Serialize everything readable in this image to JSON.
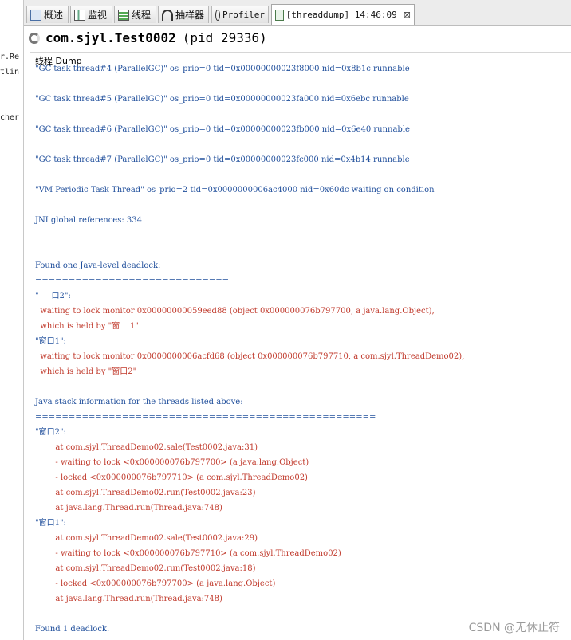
{
  "left_strip": [
    "r.Re",
    "tlin",
    "cher"
  ],
  "tabs": [
    {
      "label": "概述",
      "icon": "overview-icon"
    },
    {
      "label": "监视",
      "icon": "monitor-icon"
    },
    {
      "label": "线程",
      "icon": "threads-icon"
    },
    {
      "label": "抽样器",
      "icon": "sampler-icon"
    },
    {
      "label": "Profiler",
      "icon": "profiler-icon"
    },
    {
      "label": "[threaddump] 14:46:09",
      "icon": "threaddump-icon",
      "close": "⊠",
      "active": true
    }
  ],
  "header": {
    "app_name": "com.sjyl.Test0002",
    "pid": "(pid 29336)"
  },
  "subtab": "线程 Dump",
  "dump_lines": [
    {
      "text": "\"GC task thread#4 (ParallelGC)\" os_prio=0 tid=0x00000000023f8000 nid=0x8b1c runnable",
      "color": "blue"
    },
    {
      "text": "\"GC task thread#5 (ParallelGC)\" os_prio=0 tid=0x00000000023fa000 nid=0x6ebc runnable",
      "color": "blue"
    },
    {
      "text": "\"GC task thread#6 (ParallelGC)\" os_prio=0 tid=0x00000000023fb000 nid=0x6e40 runnable",
      "color": "blue"
    },
    {
      "text": "\"GC task thread#7 (ParallelGC)\" os_prio=0 tid=0x00000000023fc000 nid=0x4b14 runnable",
      "color": "blue"
    },
    {
      "text": "\"VM Periodic Task Thread\" os_prio=2 tid=0x0000000006ac4000 nid=0x60dc waiting on condition",
      "color": "blue"
    },
    {
      "text": "JNI global references: 334",
      "color": "blue"
    },
    {
      "text": "Found one Java-level deadlock:",
      "color": "blue"
    },
    {
      "text": "=============================",
      "color": "blue"
    },
    {
      "text": "\"     口2\":",
      "color": "blue"
    },
    {
      "text": "  waiting to lock monitor 0x00000000059eed88 (object 0x000000076b797700, a java.lang.Object),",
      "color": "red"
    },
    {
      "text": "  which is held by \"窗    1\"",
      "color": "red"
    },
    {
      "text": "\"窗口1\":",
      "color": "blue"
    },
    {
      "text": "  waiting to lock monitor 0x0000000006acfd68 (object 0x000000076b797710, a com.sjyl.ThreadDemo02),",
      "color": "red"
    },
    {
      "text": "  which is held by \"窗口2\"",
      "color": "red"
    },
    {
      "text": "Java stack information for the threads listed above:",
      "color": "blue"
    },
    {
      "text": "===================================================",
      "color": "blue"
    },
    {
      "text": "\"窗口2\":",
      "color": "blue"
    },
    {
      "text": "        at com.sjyl.ThreadDemo02.sale(Test0002.java:31)",
      "color": "red"
    },
    {
      "text": "        - waiting to lock <0x000000076b797700> (a java.lang.Object)",
      "color": "red"
    },
    {
      "text": "        - locked <0x000000076b797710> (a com.sjyl.ThreadDemo02)",
      "color": "red"
    },
    {
      "text": "        at com.sjyl.ThreadDemo02.run(Test0002.java:23)",
      "color": "red"
    },
    {
      "text": "        at java.lang.Thread.run(Thread.java:748)",
      "color": "red"
    },
    {
      "text": "\"窗口1\":",
      "color": "blue"
    },
    {
      "text": "        at com.sjyl.ThreadDemo02.sale(Test0002.java:29)",
      "color": "red"
    },
    {
      "text": "        - waiting to lock <0x000000076b797710> (a com.sjyl.ThreadDemo02)",
      "color": "red"
    },
    {
      "text": "        at com.sjyl.ThreadDemo02.run(Test0002.java:18)",
      "color": "red"
    },
    {
      "text": "        - locked <0x000000076b797700> (a java.lang.Object)",
      "color": "red"
    },
    {
      "text": "        at java.lang.Thread.run(Thread.java:748)",
      "color": "red"
    },
    {
      "text": "Found 1 deadlock.",
      "color": "blue"
    }
  ],
  "watermark": "CSDN @无休止符"
}
